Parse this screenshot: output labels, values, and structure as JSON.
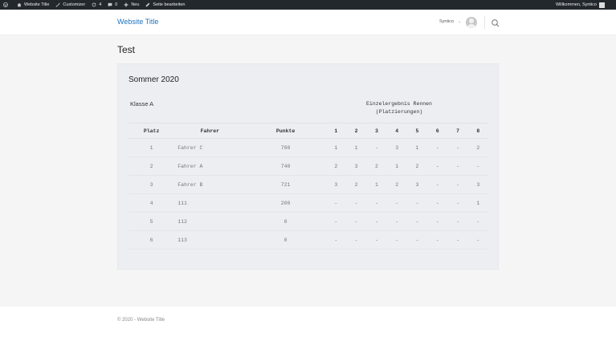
{
  "adminbar": {
    "site_name": "Website Title",
    "customizer": "Customizer",
    "updates_count": "4",
    "comments_count": "0",
    "new_label": "Neu",
    "edit_page": "Seite bearbeiten",
    "greeting": "Willkommen, Syntico"
  },
  "header": {
    "site_title": "Website Title",
    "user_name": "Syntico",
    "user_chevron": "⌄"
  },
  "page": {
    "title": "Test"
  },
  "card": {
    "season_title": "Sommer 2020",
    "class_title": "Klasse A",
    "group_title_line1": "Einzelergebnis Rennen",
    "group_title_line2": "(Platzierungen)"
  },
  "table": {
    "headers": [
      "Platz",
      "Fahrer",
      "Punkte",
      "1",
      "2",
      "3",
      "4",
      "5",
      "6",
      "7",
      "8"
    ],
    "rows": [
      [
        "1",
        "Fahrer C",
        "780",
        "1",
        "1",
        "-",
        "3",
        "1",
        "-",
        "-",
        "2"
      ],
      [
        "2",
        "Fahrer A",
        "740",
        "2",
        "3",
        "2",
        "1",
        "2",
        "-",
        "-",
        "-"
      ],
      [
        "3",
        "Fahrer B",
        "721",
        "3",
        "2",
        "1",
        "2",
        "3",
        "-",
        "-",
        "3"
      ],
      [
        "4",
        "111",
        "200",
        "-",
        "-",
        "-",
        "-",
        "-",
        "-",
        "-",
        "1"
      ],
      [
        "5",
        "112",
        "0",
        "-",
        "-",
        "-",
        "-",
        "-",
        "-",
        "-",
        "-"
      ],
      [
        "6",
        "113",
        "0",
        "-",
        "-",
        "-",
        "-",
        "-",
        "-",
        "-",
        "-"
      ]
    ]
  },
  "footer": {
    "text": "© 2020 - Website Title"
  },
  "colors": {
    "accent": "#1e73be",
    "adminbar": "#23282d",
    "card_bg": "#eceef2"
  }
}
